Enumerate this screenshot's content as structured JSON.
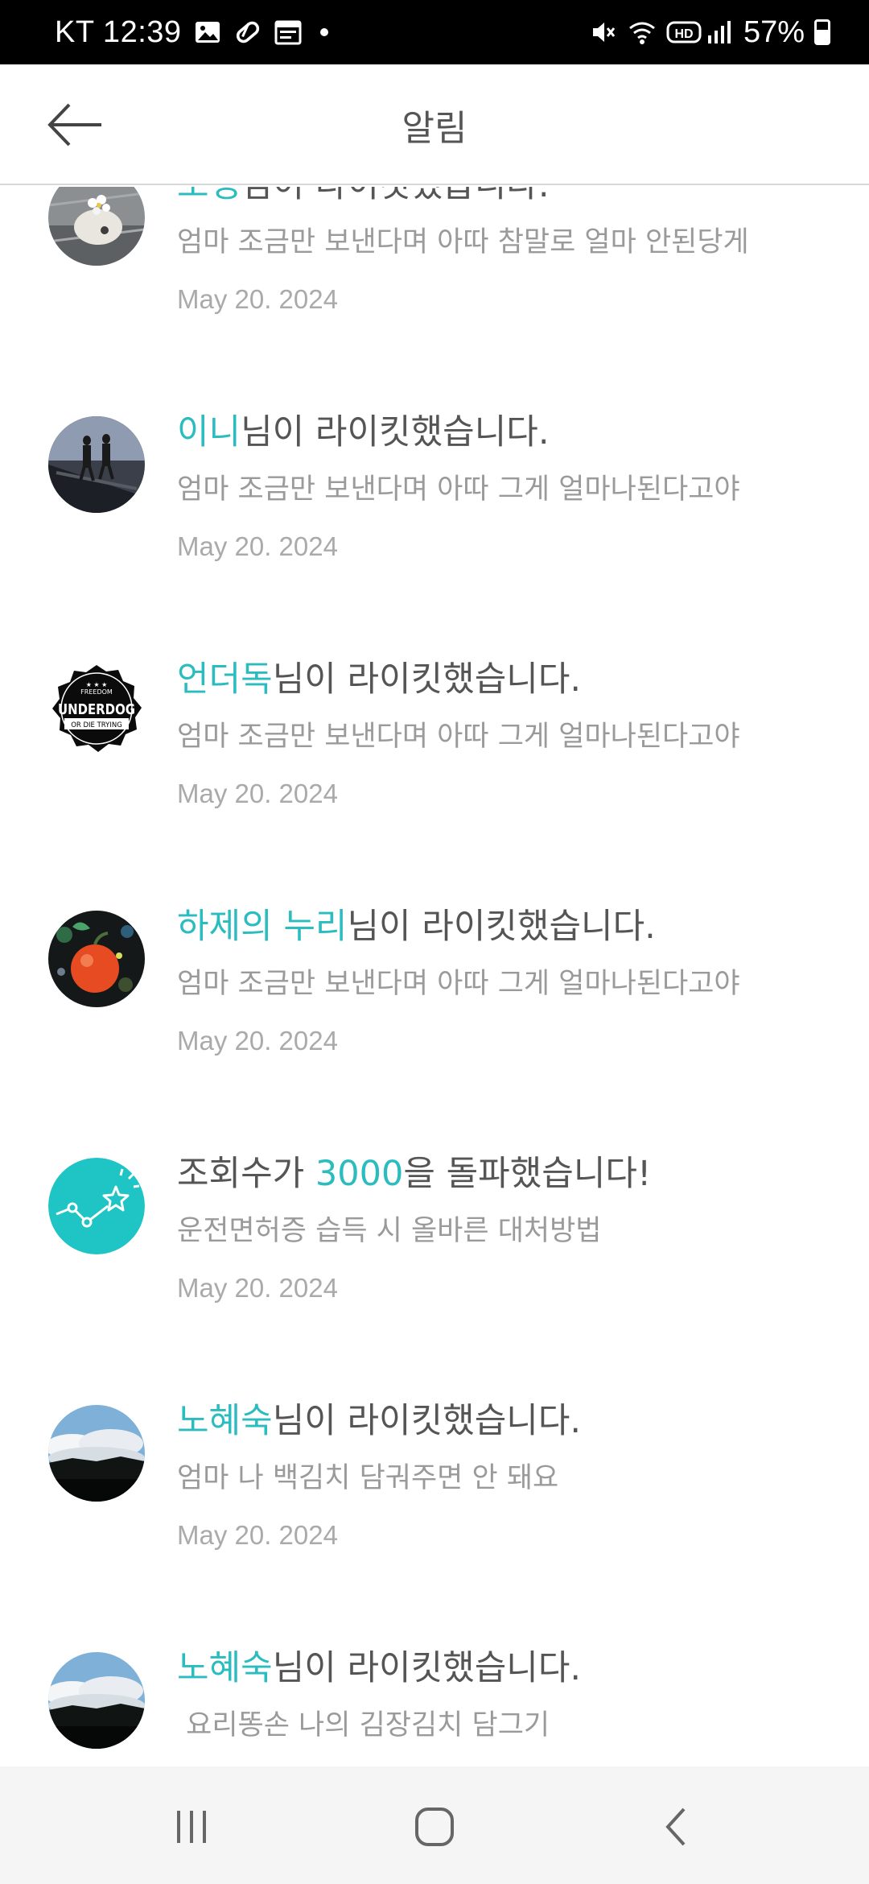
{
  "status_bar": {
    "carrier_time": "KT 12:39",
    "battery": "57%",
    "icons": [
      "gallery-icon",
      "pill-icon",
      "calendar-icon",
      "dot-icon",
      "mute-icon",
      "wifi-icon",
      "hd-icon",
      "signal-icon",
      "battery-icon"
    ]
  },
  "header": {
    "title": "알림",
    "back_icon": "arrow-left-icon"
  },
  "notifications": [
    {
      "highlight": "초맹",
      "rest": "님이 라이킷했습니다.",
      "snippet": "엄마 조금만 보낸다며 아따 참말로 얼마 안된당게",
      "date": "May 20. 2024",
      "avatar": "avatar-stone-flower"
    },
    {
      "highlight": "이니",
      "rest": "님이 라이킷했습니다.",
      "snippet": "엄마 조금만 보낸다며 아따 그게 얼마나된다고야",
      "date": "May 20. 2024",
      "avatar": "avatar-silhouettes"
    },
    {
      "highlight": "언더독",
      "rest": "님이 라이킷했습니다.",
      "snippet": "엄마 조금만 보낸다며 아따 그게 얼마나된다고야",
      "date": "May 20. 2024",
      "avatar": "avatar-underdog-badge",
      "avatar_text": {
        "top": "FREEDOM",
        "main": "UNDERDOG",
        "bottom": "OR DIE TRYING"
      }
    },
    {
      "highlight": "하제의 누리",
      "rest": "님이 라이킷했습니다.",
      "snippet": "엄마 조금만 보낸다며 아따 그게 얼마나된다고야",
      "date": "May 20. 2024",
      "avatar": "avatar-red-fruit"
    },
    {
      "prefix": "조회수가 ",
      "highlight": "3000",
      "rest": "을 돌파했습니다!",
      "snippet": "운전면허증 습득 시 올바른 대처방법",
      "date": "May 20. 2024",
      "avatar": "stats-star-icon",
      "accent_color": "#1fc4c4"
    },
    {
      "highlight": "노혜숙",
      "rest": "님이 라이킷했습니다.",
      "snippet": "엄마 나 백김치 담궈주면 안 돼요",
      "date": "May 20. 2024",
      "avatar": "avatar-clouds"
    },
    {
      "highlight": "노혜숙",
      "rest": "님이 라이킷했습니다.",
      "snippet": " 요리똥손 나의 김장김치 담그기",
      "date": "",
      "avatar": "avatar-clouds"
    }
  ],
  "colors": {
    "accent": "#2bbcc0",
    "text": "#555555",
    "muted": "#9a9a9a"
  },
  "nav_bar": {
    "icons": [
      "recents-icon",
      "home-icon",
      "back-icon"
    ]
  }
}
